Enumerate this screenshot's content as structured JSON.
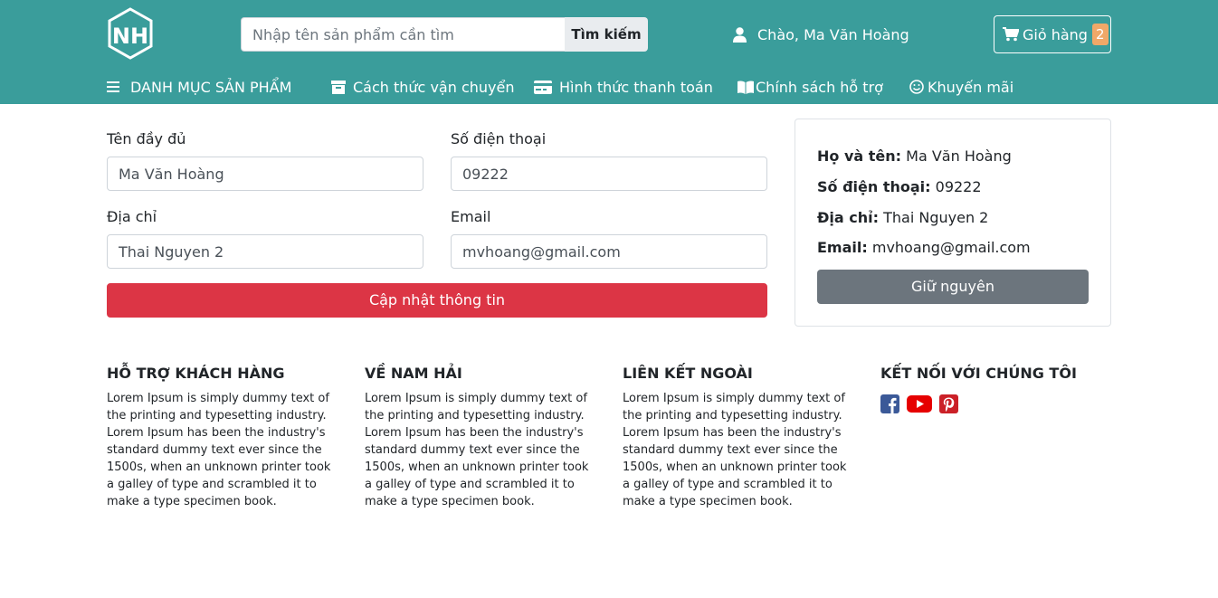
{
  "header": {
    "logo_text": "NH",
    "search": {
      "placeholder": "Nhập tên sản phẩm cần tìm",
      "button_label": "Tìm kiếm"
    },
    "greeting": "Chào, Ma Văn Hoàng",
    "cart": {
      "label": "Giỏ hàng",
      "count": "2"
    },
    "colors": {
      "background": "#3a9d9b",
      "badge": "#f0a868"
    }
  },
  "nav": {
    "categories": "DANH MỤC SẢN PHẨM",
    "shipping": "Cách thức vận chuyển",
    "payment": "Hình thức thanh toán",
    "support": "Chính sách hỗ trợ",
    "promotion": "Khuyến mãi",
    "icons": [
      "menu-icon",
      "archive-icon",
      "credit-card-icon",
      "book-icon",
      "smile-icon"
    ]
  },
  "form": {
    "fullname": {
      "label": "Tên đầy đủ",
      "value": "Ma Văn Hoàng"
    },
    "phone": {
      "label": "Số điện thoại",
      "value": "09222"
    },
    "address": {
      "label": "Địa chỉ",
      "value": "Thai Nguyen 2"
    },
    "email": {
      "label": "Email",
      "value": "mvhoang@gmail.com"
    },
    "submit_label": "Cập nhật thông tin",
    "submit_color": "#dc3545"
  },
  "info": {
    "fullname_label": "Họ và tên:",
    "fullname": "Ma Văn Hoàng",
    "phone_label": "Số điện thoại:",
    "phone": "09222",
    "address_label": "Địa chỉ:",
    "address": "Thai Nguyen 2",
    "email_label": "Email:",
    "email": "mvhoang@gmail.com",
    "keep_label": "Giữ nguyên",
    "keep_color": "#6c757d"
  },
  "footer": {
    "support": {
      "title": "HỖ TRỢ KHÁCH HÀNG",
      "text": "Lorem Ipsum is simply dummy text of the printing and typesetting industry. Lorem Ipsum has been the industry's standard dummy text ever since the 1500s, when an unknown printer took a galley of type and scrambled it to make a type specimen book."
    },
    "about": {
      "title": "VỀ NAM HẢI",
      "text": "Lorem Ipsum is simply dummy text of the printing and typesetting industry. Lorem Ipsum has been the industry's standard dummy text ever since the 1500s, when an unknown printer took a galley of type and scrambled it to make a type specimen book."
    },
    "links": {
      "title": "LIÊN KẾT NGOÀI",
      "text": "Lorem Ipsum is simply dummy text of the printing and typesetting industry. Lorem Ipsum has been the industry's standard dummy text ever since the 1500s, when an unknown printer took a galley of type and scrambled it to make a type specimen book."
    },
    "connect": {
      "title": "KẾT NỐI VỚI CHÚNG TÔI",
      "icons": [
        "facebook-icon",
        "youtube-icon",
        "pinterest-icon"
      ]
    }
  }
}
